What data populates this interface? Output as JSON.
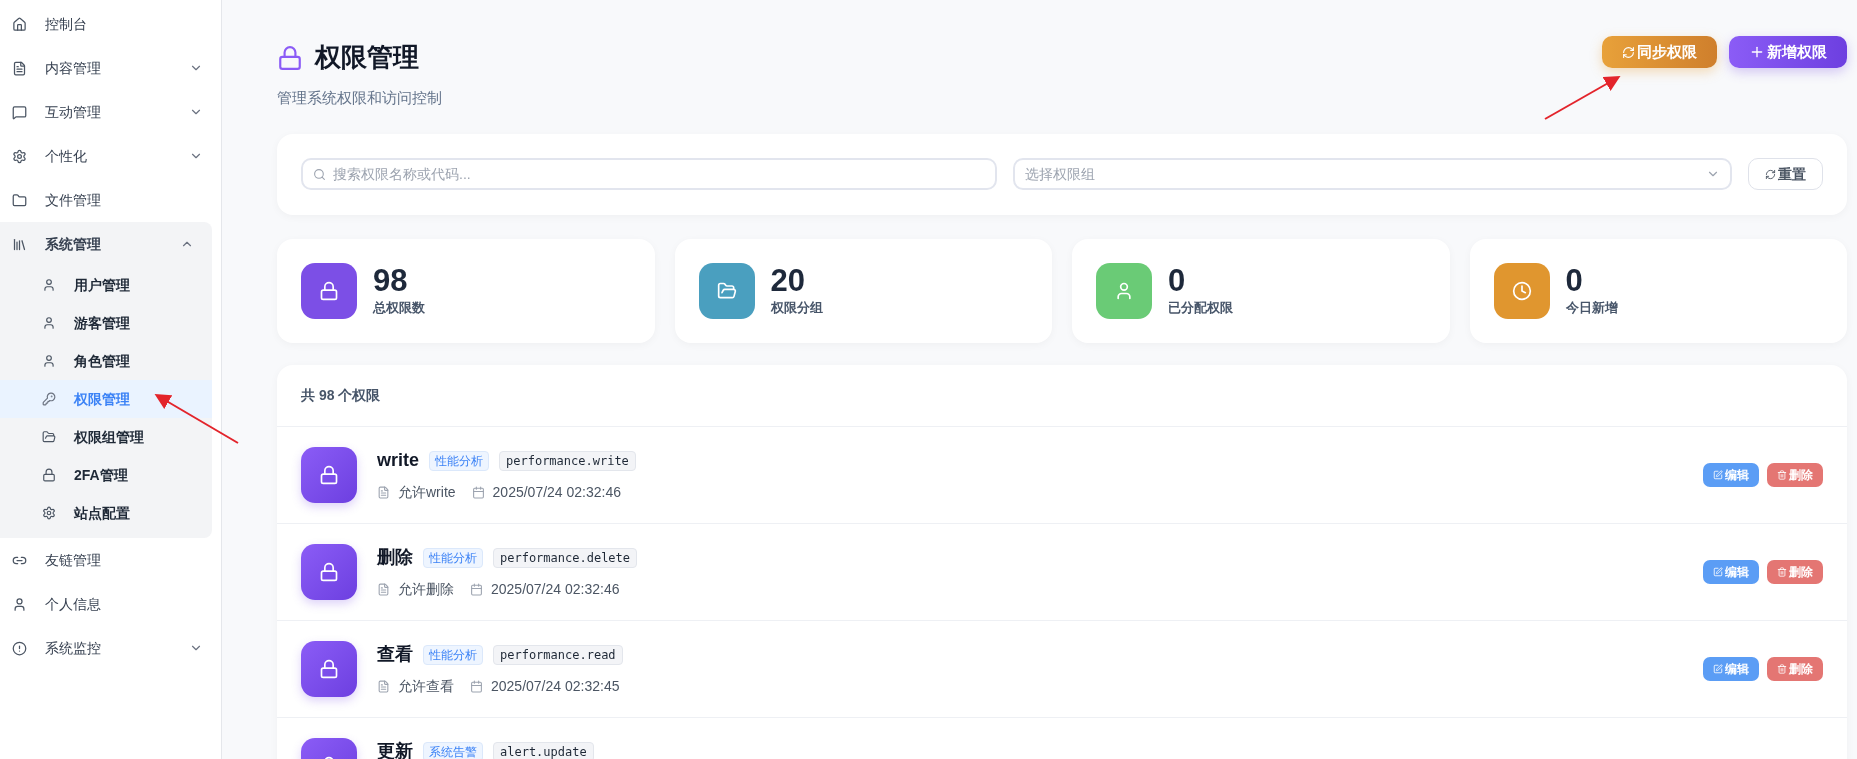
{
  "sidebar": {
    "items": [
      {
        "label": "控制台",
        "selected": false
      },
      {
        "label": "内容管理",
        "selected": false,
        "expanded": false
      },
      {
        "label": "互动管理",
        "selected": false,
        "expanded": false
      },
      {
        "label": "个性化",
        "selected": false,
        "expanded": false
      },
      {
        "label": "文件管理",
        "selected": false
      },
      {
        "label": "系统管理",
        "selected": false,
        "expanded": true,
        "children": [
          {
            "label": "用户管理",
            "selected": false
          },
          {
            "label": "游客管理",
            "selected": false
          },
          {
            "label": "角色管理",
            "selected": false
          },
          {
            "label": "权限管理",
            "selected": true
          },
          {
            "label": "权限组管理",
            "selected": false
          },
          {
            "label": "2FA管理",
            "selected": false
          },
          {
            "label": "站点配置",
            "selected": false
          }
        ]
      },
      {
        "label": "友链管理",
        "selected": false
      },
      {
        "label": "个人信息",
        "selected": false
      },
      {
        "label": "系统监控",
        "selected": false,
        "expanded": false
      }
    ]
  },
  "header": {
    "title": "权限管理",
    "subtitle": "管理系统权限和访问控制",
    "buttons": [
      {
        "label": "同步权限",
        "kind": "sync"
      },
      {
        "label": "新增权限",
        "kind": "add"
      }
    ]
  },
  "filters": {
    "search": {
      "placeholder": "搜索权限名称或代码..."
    },
    "group_select": {
      "placeholder": "选择权限组"
    },
    "reset_button": "重置"
  },
  "stats": [
    {
      "value": "98",
      "label": "总权限数",
      "color": "#7c4fe6"
    },
    {
      "value": "20",
      "label": "权限分组",
      "color": "#4a9fbf"
    },
    {
      "value": "0",
      "label": "已分配权限",
      "color": "#6acb76"
    },
    {
      "value": "0",
      "label": "今日新增",
      "color": "#e0962f"
    }
  ],
  "list": {
    "count_label": "共 98 个权限",
    "rows": [
      {
        "name": "write",
        "tag": "性能分析",
        "code": "performance.write",
        "description": "允许write",
        "time": "2025/07/24 02:32:46",
        "edit": "编辑",
        "delete": "删除"
      },
      {
        "name": "删除",
        "tag": "性能分析",
        "code": "performance.delete",
        "description": "允许删除",
        "time": "2025/07/24 02:32:46",
        "edit": "编辑",
        "delete": "删除"
      },
      {
        "name": "查看",
        "tag": "性能分析",
        "code": "performance.read",
        "description": "允许查看",
        "time": "2025/07/24 02:32:45",
        "edit": "编辑",
        "delete": "删除"
      },
      {
        "name": "更新",
        "tag": "系统告警",
        "code": "alert.update"
      }
    ]
  }
}
